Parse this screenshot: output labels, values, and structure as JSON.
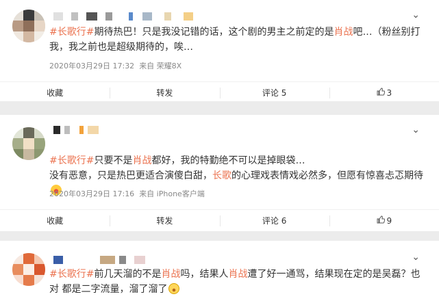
{
  "posts": [
    {
      "tag": "#长歌行#",
      "text_parts": [
        {
          "t": "期待热巴！只是我没记错的话，这个剧的男主之前定的是",
          "link": false
        },
        {
          "t": "肖战",
          "link": true
        },
        {
          "t": "吧…（粉丝别打我，我之前也是超级期待的，唉…",
          "link": false
        }
      ],
      "emoji": "",
      "timestamp": "2020年03月29日 17:32",
      "source": "来自 荣耀8X",
      "actions": {
        "collect": "收藏",
        "forward": "转发",
        "comment": "评论 5",
        "like": "3"
      }
    },
    {
      "tag": "#长歌行#",
      "text_parts": [
        {
          "t": "只要不是",
          "link": false
        },
        {
          "t": "肖战",
          "link": true
        },
        {
          "t": "都好，我的特勤绝不可以是掉眼袋…",
          "link": false
        },
        {
          "t": "\n没有恶意，只是热巴更适合演傻白甜，",
          "link": false
        },
        {
          "t": "长歌",
          "link": true
        },
        {
          "t": "的心理戏表情戏必然多，但愿有惊喜忐忑期待",
          "link": false
        }
      ],
      "emoji": "surprised-face",
      "timestamp": "2020年03月29日 17:16",
      "source": "来自 iPhone客户端",
      "actions": {
        "collect": "收藏",
        "forward": "转发",
        "comment": "评论 6",
        "like": "9"
      }
    },
    {
      "tag": "#长歌行#",
      "text_parts": [
        {
          "t": "前几天溜的不是",
          "link": false
        },
        {
          "t": "肖战",
          "link": true
        },
        {
          "t": "吗，结果人",
          "link": false
        },
        {
          "t": "肖战",
          "link": true
        },
        {
          "t": "遭了好一通骂，结果现在定的是吴磊？也对 都是二字流量，溜了溜了",
          "link": false
        }
      ],
      "emoji": "smirk-face"
    }
  ],
  "colors": {
    "link": "#eb7350",
    "meta": "#888888",
    "text": "#333333"
  },
  "icons": {
    "menu": "chevron-down-icon",
    "like": "thumbs-up-icon"
  }
}
